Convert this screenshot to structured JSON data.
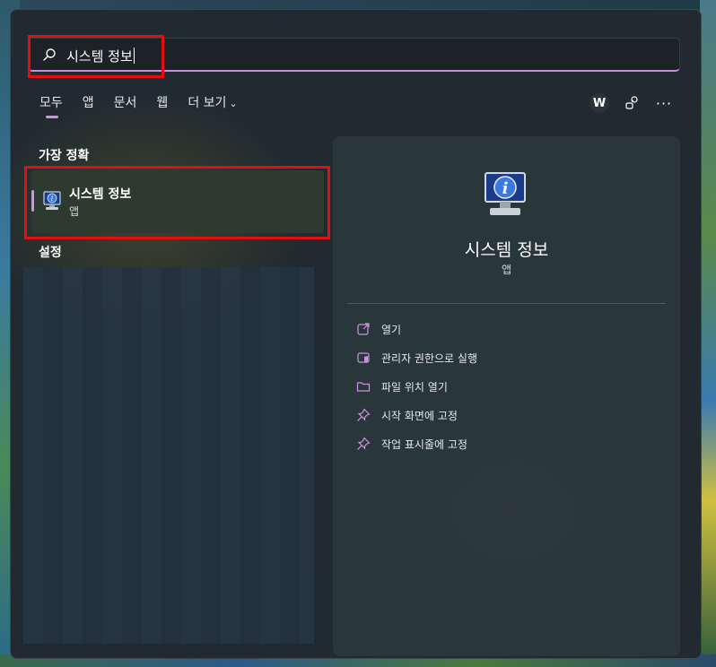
{
  "search": {
    "query": "시스템 정보"
  },
  "tabs": [
    {
      "label": "모두",
      "active": true
    },
    {
      "label": "앱"
    },
    {
      "label": "문서"
    },
    {
      "label": "웹"
    },
    {
      "label": "더 보기"
    }
  ],
  "header_icons": {
    "account_initial": "W",
    "icons": [
      "account-icon",
      "share-icon",
      "more-icon"
    ]
  },
  "best_match": {
    "section_title": "가장 정확",
    "name": "시스템 정보",
    "type": "앱"
  },
  "settings": {
    "section_title": "설정"
  },
  "detail": {
    "name": "시스템 정보",
    "type": "앱",
    "actions": [
      {
        "label": "열기",
        "icon": "open-icon"
      },
      {
        "label": "관리자 권한으로 실행",
        "icon": "admin-shield-icon"
      },
      {
        "label": "파일 위치 열기",
        "icon": "folder-icon"
      },
      {
        "label": "시작 화면에 고정",
        "icon": "pin-icon"
      },
      {
        "label": "작업 표시줄에 고정",
        "icon": "pin-icon"
      }
    ]
  },
  "colors": {
    "accent": "#d090e8",
    "highlight_box": "#e01010"
  }
}
